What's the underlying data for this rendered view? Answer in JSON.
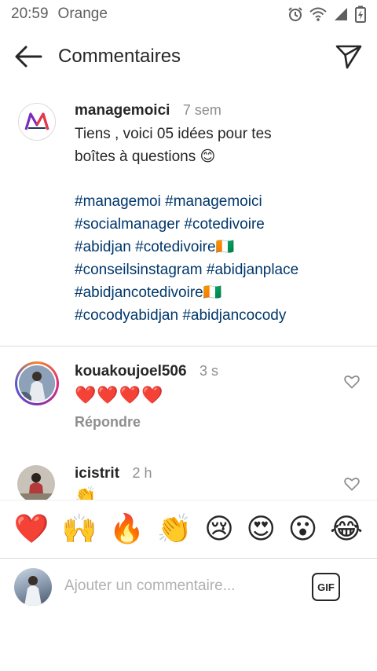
{
  "status_bar": {
    "time": "20:59",
    "carrier": "Orange",
    "icons": [
      "alarm-icon",
      "wifi-icon",
      "signal-icon",
      "battery-charging-icon"
    ]
  },
  "header": {
    "title": "Commentaires",
    "back_icon": "arrow-left-icon",
    "share_icon": "paper-plane-icon"
  },
  "caption": {
    "username": "managemoici",
    "time": "7 sem",
    "text_line1": "Tiens , voici 05 idées pour tes",
    "text_line2": "boîtes à questions 😊",
    "hashtags": [
      "#managemoi #managemoici",
      "#socialmanager #cotedivoire",
      "#abidjan #cotedivoire🇨🇮",
      "#conseilsinstagram #abidjanplace",
      "#abidjancotedivoire🇨🇮",
      "#cocodyabidjan #abidjancocody"
    ]
  },
  "comments": [
    {
      "username": "kouakoujoel506",
      "time": "3 s",
      "text": "❤️❤️❤️❤️",
      "reply_label": "Répondre"
    },
    {
      "username": "icistrit",
      "time": "2 h",
      "text": "👏"
    }
  ],
  "reactions": [
    "❤️",
    "🙌",
    "🔥",
    "👏",
    "😢",
    "😍",
    "😮",
    "😂"
  ],
  "composer": {
    "placeholder": "Ajouter un commentaire...",
    "gif_label": "GIF"
  },
  "colors": {
    "hashtag": "#00376b",
    "secondary_text": "#8e8e8e",
    "divider": "#dbdbdb"
  }
}
